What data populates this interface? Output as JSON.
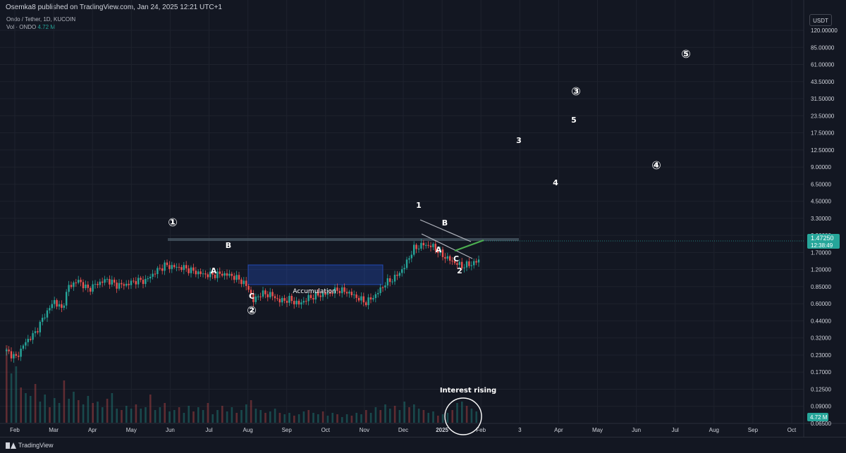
{
  "header": {
    "published_text": "Osemka8 published on TradingView.com, Jan 24, 2025 12:21 UTC+1",
    "symbol_line": "Ondo / Tether, 1D, KUCOIN",
    "vol_label": "Vol · ONDO",
    "vol_value": "4.72 M"
  },
  "footer": {
    "brand": "TradingView"
  },
  "chart_data": {
    "type": "candlestick",
    "price_scale": "log",
    "unit": "USDT",
    "y_ticks": [
      "120.00000",
      "85.00000",
      "61.00000",
      "43.50000",
      "31.50000",
      "23.50000",
      "17.50000",
      "12.50000",
      "9.00000",
      "6.50000",
      "4.50000",
      "3.30000",
      "2.30000",
      "1.70000",
      "1.20000",
      "0.85000",
      "0.60000",
      "0.44000",
      "0.32000",
      "0.23000",
      "0.17000",
      "0.12500",
      "0.09000",
      "0.06500",
      "0.04700",
      "0.03400"
    ],
    "x_ticks": [
      "Feb",
      "Mar",
      "Apr",
      "May",
      "Jun",
      "Jul",
      "Aug",
      "Sep",
      "Oct",
      "Nov",
      "Dec",
      "2025",
      "Feb",
      "3",
      "Apr",
      "May",
      "Jun",
      "Jul",
      "Aug",
      "Sep",
      "Oct"
    ],
    "last_price": "1.47250",
    "countdown": "12:38:49",
    "last_volume": "4.72 M",
    "colors": {
      "up": "#26a69a",
      "down": "#ef5350",
      "background": "#131722",
      "text": "#d1d4dc",
      "grid": "#1e222d",
      "accumulation_box": "#2962ff",
      "resistance": "#4a5a66",
      "wedge_line": "#b2b5be",
      "breakout_line": "#4caf50"
    },
    "price_path": [
      [
        0,
        0.26
      ],
      [
        4,
        0.23
      ],
      [
        8,
        0.31
      ],
      [
        12,
        0.37
      ],
      [
        16,
        0.52
      ],
      [
        20,
        0.68
      ],
      [
        23,
        0.58
      ],
      [
        26,
        0.9
      ],
      [
        30,
        1.0
      ],
      [
        34,
        0.85
      ],
      [
        38,
        0.95
      ],
      [
        42,
        1.02
      ],
      [
        46,
        0.92
      ],
      [
        50,
        0.93
      ],
      [
        54,
        1.0
      ],
      [
        58,
        1.0
      ],
      [
        62,
        1.18
      ],
      [
        66,
        1.34
      ],
      [
        70,
        1.3
      ],
      [
        74,
        1.28
      ],
      [
        78,
        1.2
      ],
      [
        82,
        1.13
      ],
      [
        86,
        1.12
      ],
      [
        90,
        1.14
      ],
      [
        94,
        1.1
      ],
      [
        98,
        1.0
      ],
      [
        101,
        0.86
      ],
      [
        103,
        0.68
      ],
      [
        106,
        0.78
      ],
      [
        110,
        0.77
      ],
      [
        114,
        0.68
      ],
      [
        118,
        0.7
      ],
      [
        122,
        0.64
      ],
      [
        126,
        0.72
      ],
      [
        130,
        0.76
      ],
      [
        134,
        0.78
      ],
      [
        138,
        0.84
      ],
      [
        142,
        0.81
      ],
      [
        146,
        0.73
      ],
      [
        150,
        0.66
      ],
      [
        154,
        0.76
      ],
      [
        158,
        0.95
      ],
      [
        162,
        1.06
      ],
      [
        166,
        1.3
      ],
      [
        168,
        1.58
      ],
      [
        170,
        1.85
      ],
      [
        174,
        2.0
      ],
      [
        178,
        1.92
      ],
      [
        182,
        1.62
      ],
      [
        186,
        1.45
      ],
      [
        190,
        1.32
      ],
      [
        194,
        1.38
      ],
      [
        197,
        1.47
      ]
    ],
    "volumes": [
      [
        0,
        110
      ],
      [
        2,
        70
      ],
      [
        4,
        80
      ],
      [
        6,
        50
      ],
      [
        8,
        42
      ],
      [
        10,
        38
      ],
      [
        12,
        55
      ],
      [
        14,
        30
      ],
      [
        16,
        40
      ],
      [
        18,
        22
      ],
      [
        20,
        35
      ],
      [
        22,
        28
      ],
      [
        24,
        60
      ],
      [
        26,
        34
      ],
      [
        28,
        44
      ],
      [
        30,
        32
      ],
      [
        32,
        26
      ],
      [
        34,
        38
      ],
      [
        36,
        28
      ],
      [
        38,
        30
      ],
      [
        40,
        22
      ],
      [
        42,
        34
      ],
      [
        44,
        42
      ],
      [
        46,
        20
      ],
      [
        48,
        18
      ],
      [
        50,
        24
      ],
      [
        52,
        20
      ],
      [
        54,
        26
      ],
      [
        56,
        20
      ],
      [
        58,
        22
      ],
      [
        60,
        40
      ],
      [
        62,
        18
      ],
      [
        64,
        22
      ],
      [
        66,
        28
      ],
      [
        68,
        16
      ],
      [
        70,
        18
      ],
      [
        72,
        22
      ],
      [
        74,
        14
      ],
      [
        76,
        24
      ],
      [
        78,
        16
      ],
      [
        80,
        22
      ],
      [
        82,
        18
      ],
      [
        84,
        28
      ],
      [
        86,
        12
      ],
      [
        88,
        18
      ],
      [
        90,
        24
      ],
      [
        92,
        16
      ],
      [
        94,
        22
      ],
      [
        96,
        14
      ],
      [
        98,
        18
      ],
      [
        100,
        26
      ],
      [
        102,
        32
      ],
      [
        104,
        20
      ],
      [
        106,
        18
      ],
      [
        108,
        14
      ],
      [
        110,
        16
      ],
      [
        112,
        20
      ],
      [
        114,
        14
      ],
      [
        116,
        12
      ],
      [
        118,
        14
      ],
      [
        120,
        10
      ],
      [
        122,
        12
      ],
      [
        124,
        16
      ],
      [
        126,
        18
      ],
      [
        128,
        14
      ],
      [
        130,
        12
      ],
      [
        132,
        16
      ],
      [
        134,
        10
      ],
      [
        136,
        14
      ],
      [
        138,
        12
      ],
      [
        140,
        8
      ],
      [
        142,
        12
      ],
      [
        144,
        10
      ],
      [
        146,
        14
      ],
      [
        148,
        12
      ],
      [
        150,
        18
      ],
      [
        152,
        14
      ],
      [
        154,
        22
      ],
      [
        156,
        18
      ],
      [
        158,
        26
      ],
      [
        160,
        20
      ],
      [
        162,
        24
      ],
      [
        164,
        18
      ],
      [
        166,
        30
      ],
      [
        168,
        22
      ],
      [
        170,
        26
      ],
      [
        172,
        20
      ],
      [
        174,
        18
      ],
      [
        176,
        14
      ],
      [
        178,
        16
      ],
      [
        180,
        10
      ],
      [
        182,
        12
      ],
      [
        184,
        14
      ],
      [
        186,
        18
      ],
      [
        188,
        28
      ],
      [
        190,
        30
      ],
      [
        192,
        24
      ],
      [
        194,
        20
      ],
      [
        196,
        16
      ]
    ],
    "annotations": {
      "wave_top_1": "①",
      "wave_b_1": "B",
      "wave_a_1": "A",
      "wave_c_1": "C",
      "wave_2_circle": "②",
      "accumulation": "Accumulation",
      "wave_1_minor": "1",
      "wave_b_2": "B",
      "wave_a_2": "A",
      "wave_c_2": "C",
      "wave_2_minor": "2",
      "wave_3_minor": "3",
      "wave_4_minor": "4",
      "wave_5_minor": "5",
      "wave_3_circle": "③",
      "wave_4_circle": "④",
      "wave_5_circle": "⑤",
      "interest_rising": "Interest rising"
    }
  }
}
